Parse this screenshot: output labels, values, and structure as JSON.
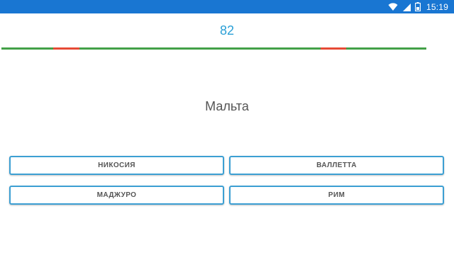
{
  "status_bar": {
    "time": "15:19",
    "icons": [
      "wifi-icon",
      "cellular-signal-icon",
      "battery-icon"
    ],
    "color": "#1976d2"
  },
  "quiz": {
    "score": "82",
    "question": "Мальта",
    "answers": [
      "НИКОСИЯ",
      "ВАЛЛЕТТА",
      "МАДЖУРО",
      "РИМ"
    ]
  },
  "progress": {
    "colors": {
      "correct": "#43a047",
      "wrong": "#e64a35"
    },
    "segments": [
      "correct",
      "wrong",
      "correct",
      "wrong",
      "correct"
    ]
  }
}
